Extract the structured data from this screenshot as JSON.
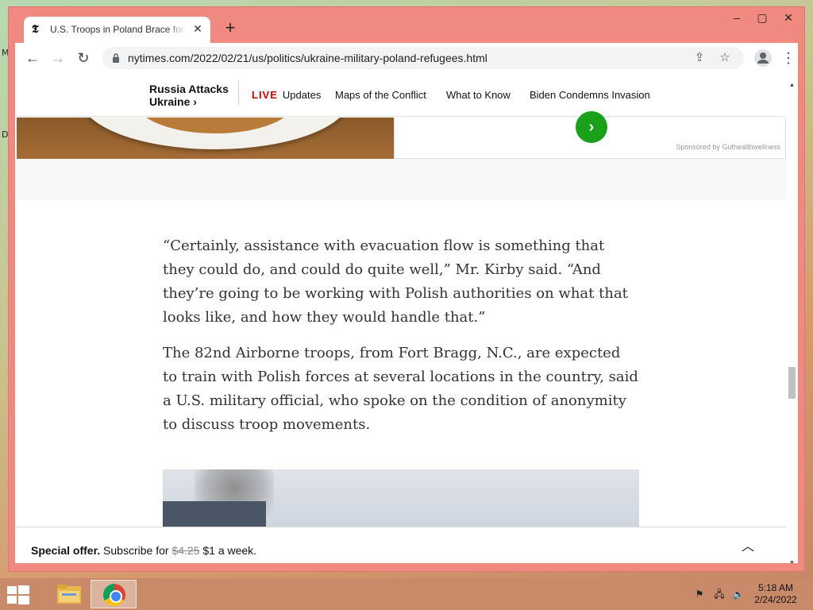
{
  "desktop": {
    "labels": [
      "M",
      "D"
    ]
  },
  "browser": {
    "tab_title": "U.S. Troops in Poland Brace for Possible Refugee Crisis",
    "tab_favicon": "𝕿",
    "tab_close_icon": "close-icon",
    "new_tab_icon": "plus-icon",
    "window_controls": {
      "minimize": "–",
      "maximize": "▢",
      "close": "✕"
    },
    "url": "nytimes.com/2022/02/21/us/politics/ukraine-military-poland-refugees.html"
  },
  "page": {
    "topbar": {
      "section_title_line1": "Russia Attacks",
      "section_title_line2": "Ukraine ›",
      "live_label": "LIVE",
      "live_updates": "Updates",
      "links": [
        "Maps of the Conflict",
        "What to Know",
        "Biden Condemns Invasion"
      ]
    },
    "ad": {
      "go_label": "›",
      "sponsor": "Sponsored by Guthealthwellness"
    },
    "paragraphs": [
      "“Certainly, assistance with evacuation flow is something that they could do, and could do quite well,” Mr. Kirby said. “And they’re going to be working with Polish authorities on what that looks like, and how they would handle that.”",
      "The 82nd Airborne troops, from Fort Bragg, N.C., are expected to train with Polish forces at several locations in the country, said a U.S. military official, who spoke on the condition of anonymity to discuss troop movements."
    ],
    "offer": {
      "label": "Special offer.",
      "text": "Subscribe for",
      "old_price": "$4.25",
      "new_price": "$1 a week."
    }
  },
  "taskbar": {
    "time": "5:18 AM",
    "date": "2/24/2022"
  }
}
